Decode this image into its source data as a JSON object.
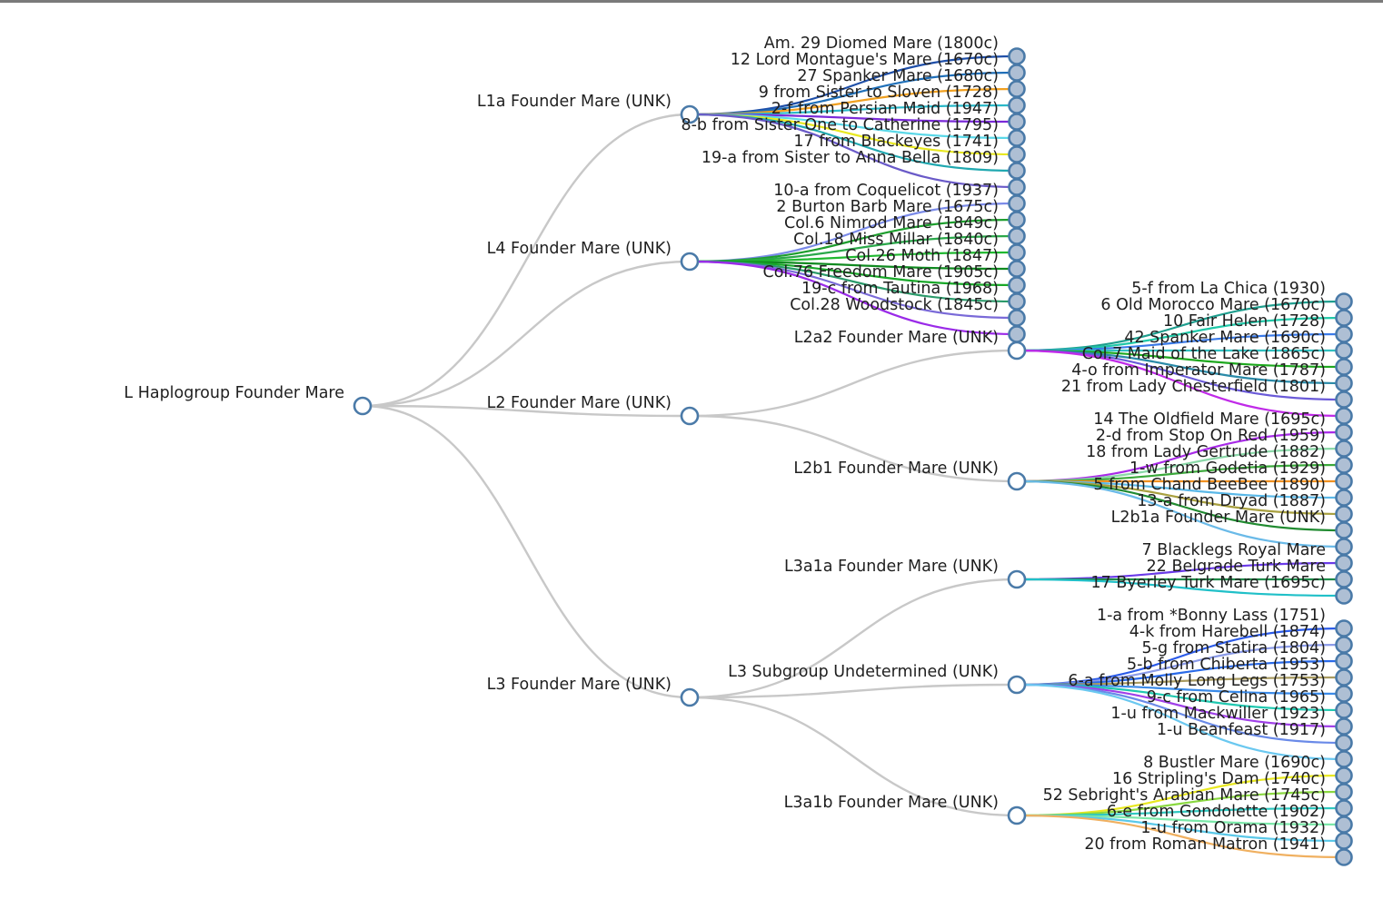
{
  "tree": {
    "name": "L Haplogroup Founder Mare",
    "children": [
      {
        "name": "L1a Founder Mare (UNK)",
        "children": [
          {
            "name": "Am. 29 Diomed Mare (1800c)",
            "color": "#1f4fa8"
          },
          {
            "name": "12 Lord Montague's Mare (1670c)",
            "color": "#1f6fb8"
          },
          {
            "name": "27 Spanker Mare (1680c)",
            "color": "#f0a020"
          },
          {
            "name": "9 from Sister to Sloven (1728)",
            "color": "#2ab8c8"
          },
          {
            "name": "2-f from Persian Maid (1947)",
            "color": "#7a2ad8"
          },
          {
            "name": "8-b from Sister One to Catherine (1795)",
            "color": "#5ad8e8"
          },
          {
            "name": "17 from Blackeyes (1741)",
            "color": "#e8e820"
          },
          {
            "name": "19-a from Sister to Anna Bella (1809)",
            "color": "#20a8b0"
          },
          {
            "name": "",
            "color": "#6a5ac8"
          }
        ]
      },
      {
        "name": "L4 Founder Mare (UNK)",
        "children": [
          {
            "name": "10-a from Coquelicot (1937)",
            "color": "#7a8ae8"
          },
          {
            "name": "2 Burton Barb Mare (1675c)",
            "color": "#1e9e2e"
          },
          {
            "name": "Col.6 Nimrod Mare (1849c)",
            "color": "#2aa84a"
          },
          {
            "name": "Col.18 Miss Millar (1840c)",
            "color": "#20b830"
          },
          {
            "name": "Col.26 Moth (1847)",
            "color": "#108a20"
          },
          {
            "name": "Col.76 Freedom Mare (1905c)",
            "color": "#18a828"
          },
          {
            "name": "19-c from Tautina (1968)",
            "color": "#2a9a6a"
          },
          {
            "name": "Col.28 Woodstock (1845c)",
            "color": "#7a6ad8"
          },
          {
            "name": "",
            "color": "#9a2ae8"
          }
        ]
      },
      {
        "name": "L2 Founder Mare (UNK)",
        "children": [
          {
            "name": "L2a2 Founder Mare (UNK)",
            "children": [
              {
                "name": "5-f from La Chica (1930)",
                "color": "#1e9e8e"
              },
              {
                "name": "6 Old Morocco Mare (1670c)",
                "color": "#20c8a8"
              },
              {
                "name": "10 Fair Helen (1728)",
                "color": "#3a7ae8"
              },
              {
                "name": "42 Spanker Mare (1690c)",
                "color": "#30c0c0"
              },
              {
                "name": "Col.7 Maid of the Lake (1865c)",
                "color": "#1ea81e"
              },
              {
                "name": "4-o from Imperator Mare (1787)",
                "color": "#2a8aa8"
              },
              {
                "name": "21 from Lady Chesterfield (1801)",
                "color": "#6a5ad8"
              },
              {
                "name": "",
                "color": "#c02ae8"
              }
            ]
          },
          {
            "name": "L2b1 Founder Mare (UNK)",
            "children": [
              {
                "name": "14 The Oldfield Mare (1695c)",
                "color": "#a82ae8"
              },
              {
                "name": "2-d from Stop On Red (1959)",
                "color": "#8ad8a8"
              },
              {
                "name": "18 from Lady Gertrude (1882)",
                "color": "#3aa83a"
              },
              {
                "name": "1-w from Godetia (1929)",
                "color": "#f09020"
              },
              {
                "name": "5 from Chand BeeBee (1890)",
                "color": "#5ab8e8"
              },
              {
                "name": "13-a from Dryad (1887)",
                "color": "#a8a040"
              },
              {
                "name": "L2b1a Founder Mare (UNK)",
                "color": "#208a30"
              },
              {
                "name": "",
                "color": "#6abae8"
              }
            ]
          }
        ]
      },
      {
        "name": "L3 Founder Mare (UNK)",
        "children": [
          {
            "name": "L3a1a Founder Mare (UNK)",
            "children": [
              {
                "name": "7 Blacklegs Royal Mare",
                "color": "#6a3ae8"
              },
              {
                "name": "22 Belgrade Turk Mare",
                "color": "#208a4a"
              },
              {
                "name": "17 Byerley Turk Mare (1695c)",
                "color": "#20c0c8"
              }
            ]
          },
          {
            "name": "L3 Subgroup Undetermined (UNK)",
            "children": [
              {
                "name": "1-a from *Bonny Lass (1751)",
                "color": "#2a5ae8"
              },
              {
                "name": "4-k from Harebell (1874)",
                "color": "#8a9ae8"
              },
              {
                "name": "5-g from Statira (1804)",
                "color": "#2a6ae8"
              },
              {
                "name": "5-b from Chiberta (1953)",
                "color": "#a89a60"
              },
              {
                "name": "6-a from Molly Long Legs (1753)",
                "color": "#3a8ae8"
              },
              {
                "name": "9-c from Celina (1965)",
                "color": "#20c8b0"
              },
              {
                "name": "1-u from Mackwiller (1923)",
                "color": "#a040e8"
              },
              {
                "name": "1-u Beanfeast (1917)",
                "color": "#6a8ae8"
              },
              {
                "name": "",
                "color": "#6ac8f0"
              }
            ]
          },
          {
            "name": "L3a1b Founder Mare (UNK)",
            "children": [
              {
                "name": "8 Bustler Mare (1690c)",
                "color": "#e8e820"
              },
              {
                "name": "16 Stripling's Dam (1740c)",
                "color": "#8ad840"
              },
              {
                "name": "52 Sebright's Arabian Mare (1745c)",
                "color": "#30c8c0"
              },
              {
                "name": "6-e from Gondolette (1902)",
                "color": "#7ae8a8"
              },
              {
                "name": "1-u from Orama (1932)",
                "color": "#5ac8e8"
              },
              {
                "name": "20 from Roman Matron (1941)",
                "color": "#f0b060"
              }
            ]
          }
        ]
      }
    ]
  }
}
